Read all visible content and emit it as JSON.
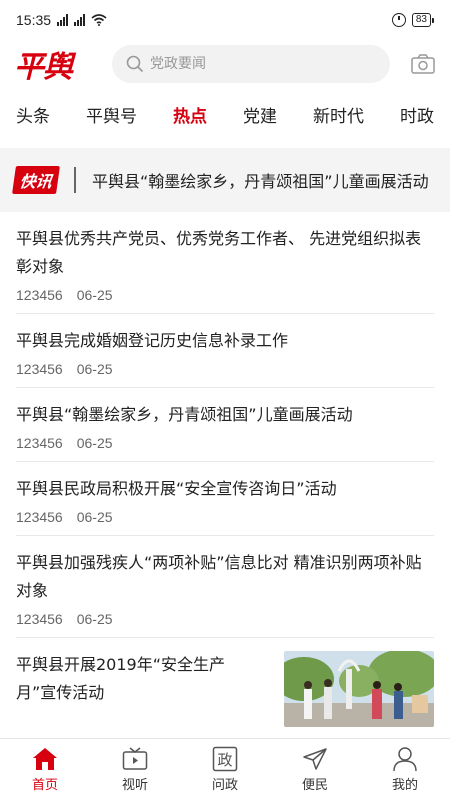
{
  "status_bar": {
    "time": "15:35",
    "signal1_label": "4G",
    "signal2_label": "4G",
    "battery": "83"
  },
  "header": {
    "logo": "平舆",
    "search_placeholder": "党政要闻"
  },
  "tabs": [
    {
      "label": "头条",
      "active": false
    },
    {
      "label": "平舆号",
      "active": false
    },
    {
      "label": "热点",
      "active": true
    },
    {
      "label": "党建",
      "active": false
    },
    {
      "label": "新时代",
      "active": false
    },
    {
      "label": "时政",
      "active": false
    }
  ],
  "flash": {
    "badge": "快讯",
    "text": "平舆县“翰墨绘家乡，丹青颂祖国”儿童画展活动"
  },
  "news": [
    {
      "title": "平舆县优秀共产党员、优秀党务工作者、 先进党组织拟表彰对象",
      "views": "123456",
      "date": "06-25"
    },
    {
      "title": "平舆县完成婚姻登记历史信息补录工作",
      "views": "123456",
      "date": "06-25"
    },
    {
      "title": "平舆县“翰墨绘家乡，丹青颂祖国”儿童画展活动",
      "views": "123456",
      "date": "06-25"
    },
    {
      "title": "平舆县民政局积极开展“安全宣传咨询日”活动",
      "views": "123456",
      "date": "06-25"
    },
    {
      "title": "平舆县加强残疾人“两项补贴”信息比对 精准识别两项补贴对象",
      "views": "123456",
      "date": "06-25"
    },
    {
      "title": "平舆县开展2019年“安全生产月”宣传活动"
    }
  ],
  "bottom_nav": [
    {
      "label": "首页",
      "icon": "home-icon",
      "active": true
    },
    {
      "label": "视听",
      "icon": "tv-icon",
      "active": false
    },
    {
      "label": "问政",
      "icon": "politics-icon",
      "icon_text": "政",
      "active": false
    },
    {
      "label": "便民",
      "icon": "send-icon",
      "active": false
    },
    {
      "label": "我的",
      "icon": "user-icon",
      "active": false
    }
  ],
  "colors": {
    "brand": "#d6000f",
    "text": "#222222",
    "muted": "#666666"
  }
}
